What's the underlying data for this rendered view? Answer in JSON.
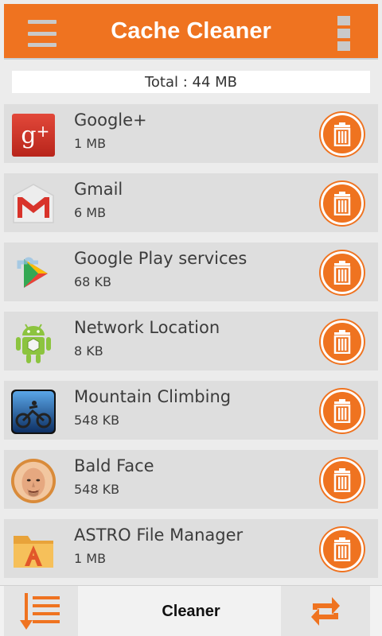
{
  "app": {
    "title": "Cache Cleaner"
  },
  "colors": {
    "accent": "#ef7320",
    "row_bg": "#dedede",
    "background": "#ececec"
  },
  "summary": {
    "total_text": "Total : 44 MB"
  },
  "apps": [
    {
      "name": "Google+",
      "size": "1 MB",
      "icon": "google-plus-icon"
    },
    {
      "name": "Gmail",
      "size": "6 MB",
      "icon": "gmail-icon"
    },
    {
      "name": "Google Play services",
      "size": "68 KB",
      "icon": "google-play-services-icon"
    },
    {
      "name": "Network Location",
      "size": "8 KB",
      "icon": "android-robot-icon"
    },
    {
      "name": "Mountain Climbing",
      "size": "548 KB",
      "icon": "mountain-climbing-game-icon"
    },
    {
      "name": "Bald Face",
      "size": "548 KB",
      "icon": "bald-face-icon"
    },
    {
      "name": "ASTRO File Manager",
      "size": "1 MB",
      "icon": "astro-folder-icon"
    }
  ],
  "bottom_nav": {
    "title": "Cleaner",
    "left_icon": "sort-list-icon",
    "right_icon": "refresh-icon"
  }
}
